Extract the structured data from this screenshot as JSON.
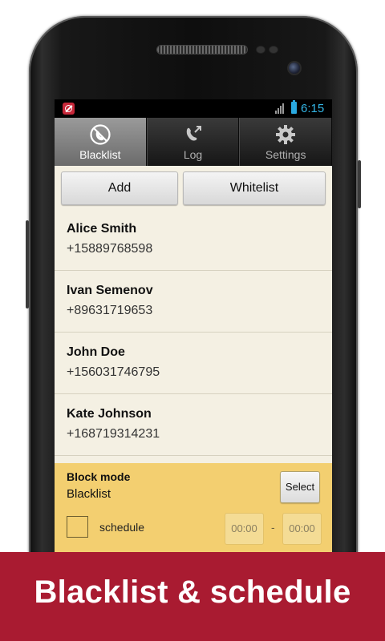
{
  "status_bar": {
    "time": "6:15"
  },
  "tabs": [
    {
      "label": "Blacklist",
      "icon": "blocked-call-icon",
      "active": true
    },
    {
      "label": "Log",
      "icon": "call-log-icon",
      "active": false
    },
    {
      "label": "Settings",
      "icon": "gear-icon",
      "active": false
    }
  ],
  "actions": {
    "add_label": "Add",
    "whitelist_label": "Whitelist"
  },
  "contacts": [
    {
      "name": "Alice Smith",
      "phone": "+15889768598"
    },
    {
      "name": "Ivan Semenov",
      "phone": "+89631719653"
    },
    {
      "name": "John Doe",
      "phone": "+156031746795"
    },
    {
      "name": "Kate Johnson",
      "phone": "+168719314231"
    }
  ],
  "block_mode": {
    "title": "Block mode",
    "value": "Blacklist",
    "select_label": "Select",
    "schedule_label": "schedule",
    "schedule_checked": false,
    "time_from": "00:00",
    "time_separator": "-",
    "time_to": "00:00"
  },
  "banner": {
    "text": "Blacklist & schedule"
  },
  "colors": {
    "banner_bg": "#a91b31",
    "panel_bg": "#f3cf70",
    "list_bg": "#f4f0e3",
    "clock": "#33b5e5",
    "battery": "#2aa9e0",
    "app_icon": "#c8283a"
  }
}
